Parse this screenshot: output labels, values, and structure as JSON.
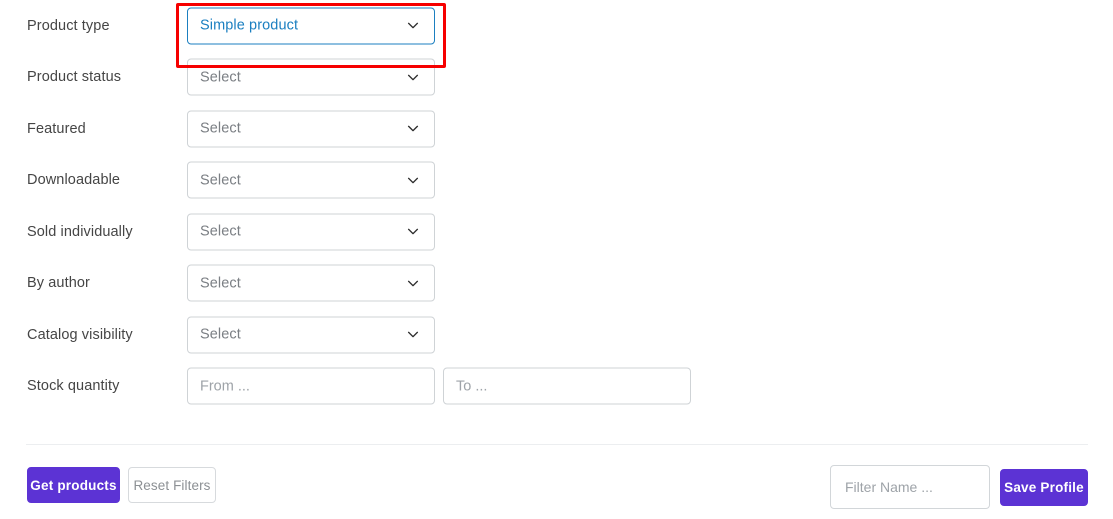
{
  "form": {
    "rows": [
      {
        "label": "Product type",
        "control": "select",
        "value": "Simple product",
        "active": true,
        "highlighted": true
      },
      {
        "label": "Product status",
        "control": "select",
        "value": "Select",
        "active": false,
        "highlighted": false
      },
      {
        "label": "Featured",
        "control": "select",
        "value": "Select",
        "active": false,
        "highlighted": false
      },
      {
        "label": "Downloadable",
        "control": "select",
        "value": "Select",
        "active": false,
        "highlighted": false
      },
      {
        "label": "Sold individually",
        "control": "select",
        "value": "Select",
        "active": false,
        "highlighted": false
      },
      {
        "label": "By author",
        "control": "select",
        "value": "Select",
        "active": false,
        "highlighted": false
      },
      {
        "label": "Catalog visibility",
        "control": "select",
        "value": "Select",
        "active": false,
        "highlighted": false
      },
      {
        "label": "Stock quantity",
        "control": "range",
        "from_placeholder": "From ...",
        "to_placeholder": "To ...",
        "from_value": "",
        "to_value": "",
        "active": false,
        "highlighted": false
      }
    ]
  },
  "footer": {
    "get_products_label": "Get products",
    "reset_filters_label": "Reset Filters",
    "filter_name_placeholder": "Filter Name ...",
    "filter_name_value": "",
    "save_profile_label": "Save Profile"
  },
  "icons": {
    "chevron": "chevron-down-icon"
  },
  "colors": {
    "primary_purple": "#5c33d4",
    "focus_blue": "#1b7fc0",
    "annotation_red": "#f60000",
    "label_gray": "#454545",
    "placeholder_gray": "#9ea3a8",
    "border_gray": "#cfd3d6"
  }
}
